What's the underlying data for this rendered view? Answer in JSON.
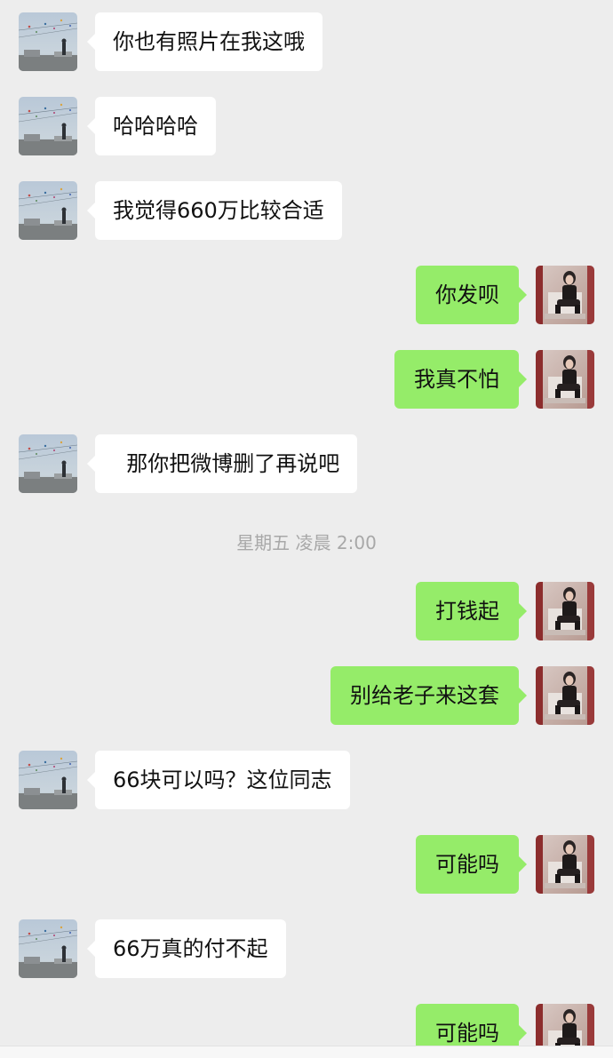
{
  "messages": [
    {
      "side": "in",
      "text": "你也有照片在我这哦"
    },
    {
      "side": "in",
      "text": "哈哈哈哈"
    },
    {
      "side": "in",
      "text": "我觉得660万比较合适"
    },
    {
      "side": "out",
      "text": "你发呗"
    },
    {
      "side": "out",
      "text": "我真不怕"
    },
    {
      "side": "in",
      "text": "  那你把微博删了再说吧"
    },
    {
      "side": "out",
      "text": "打钱起"
    },
    {
      "side": "out",
      "text": "别给老子来这套"
    },
    {
      "side": "in",
      "text": "66块可以吗？这位同志"
    },
    {
      "side": "out",
      "text": "可能吗"
    },
    {
      "side": "in",
      "text": "66万真的付不起"
    },
    {
      "side": "out",
      "text": "可能吗"
    }
  ],
  "timestamp": "星期五 凌晨 2:00",
  "colors": {
    "background": "#ededed",
    "incoming_bubble": "#ffffff",
    "outgoing_bubble": "#95ec69",
    "timestamp_text": "#a8a8a8"
  },
  "icons": {
    "incoming_avatar": "kite-beach-photo-avatar",
    "outgoing_avatar": "person-portrait-photo-avatar"
  }
}
